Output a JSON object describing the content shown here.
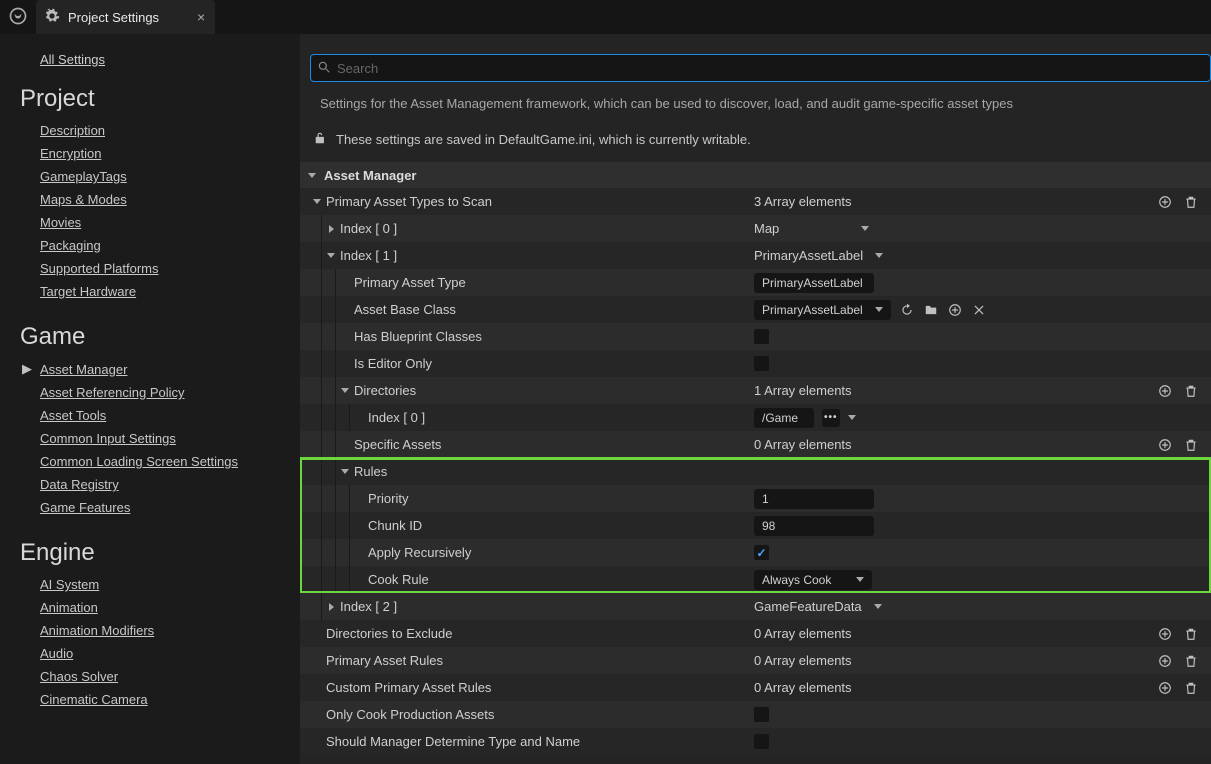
{
  "tab": {
    "title": "Project Settings"
  },
  "sidebar": {
    "all_settings": "All Settings",
    "categories": [
      {
        "name": "Project",
        "items": [
          {
            "label": "Description"
          },
          {
            "label": "Encryption"
          },
          {
            "label": "GameplayTags"
          },
          {
            "label": "Maps & Modes"
          },
          {
            "label": "Movies"
          },
          {
            "label": "Packaging"
          },
          {
            "label": "Supported Platforms"
          },
          {
            "label": "Target Hardware"
          }
        ]
      },
      {
        "name": "Game",
        "items": [
          {
            "label": "Asset Manager",
            "active": true
          },
          {
            "label": "Asset Referencing Policy"
          },
          {
            "label": "Asset Tools"
          },
          {
            "label": "Common Input Settings"
          },
          {
            "label": "Common Loading Screen Settings"
          },
          {
            "label": "Data Registry"
          },
          {
            "label": "Game Features"
          }
        ]
      },
      {
        "name": "Engine",
        "items": [
          {
            "label": "AI System"
          },
          {
            "label": "Animation"
          },
          {
            "label": "Animation Modifiers"
          },
          {
            "label": "Audio"
          },
          {
            "label": "Chaos Solver"
          },
          {
            "label": "Cinematic Camera"
          }
        ]
      }
    ]
  },
  "search": {
    "placeholder": "Search"
  },
  "header": {
    "description": "Settings for the Asset Management framework, which can be used to discover, load, and audit game-specific asset types",
    "save_note": "These settings are saved in DefaultGame.ini, which is currently writable."
  },
  "section": {
    "title": "Asset Manager"
  },
  "props": {
    "primary_types_label": "Primary Asset Types to Scan",
    "primary_types_count": "3 Array elements",
    "idx0": {
      "label": "Index [ 0 ]",
      "value": "Map"
    },
    "idx1": {
      "label": "Index [ 1 ]",
      "value": "PrimaryAssetLabel"
    },
    "primary_asset_type": {
      "label": "Primary Asset Type",
      "value": "PrimaryAssetLabel"
    },
    "asset_base_class": {
      "label": "Asset Base Class",
      "value": "PrimaryAssetLabel"
    },
    "has_bp": {
      "label": "Has Blueprint Classes"
    },
    "editor_only": {
      "label": "Is Editor Only"
    },
    "directories": {
      "label": "Directories",
      "count": "1 Array elements"
    },
    "dir0": {
      "label": "Index [ 0 ]",
      "value": "/Game"
    },
    "specific": {
      "label": "Specific Assets",
      "count": "0 Array elements"
    },
    "rules": {
      "label": "Rules"
    },
    "priority": {
      "label": "Priority",
      "value": "1"
    },
    "chunk": {
      "label": "Chunk ID",
      "value": "98"
    },
    "apply_rec": {
      "label": "Apply Recursively"
    },
    "cook_rule": {
      "label": "Cook Rule",
      "value": "Always Cook"
    },
    "idx2": {
      "label": "Index [ 2 ]",
      "value": "GameFeatureData"
    },
    "dir_exclude": {
      "label": "Directories to Exclude",
      "count": "0 Array elements"
    },
    "par": {
      "label": "Primary Asset Rules",
      "count": "0 Array elements"
    },
    "cpar": {
      "label": "Custom Primary Asset Rules",
      "count": "0 Array elements"
    },
    "only_cook": {
      "label": "Only Cook Production Assets"
    },
    "should_mgr": {
      "label": "Should Manager Determine Type and Name"
    }
  }
}
